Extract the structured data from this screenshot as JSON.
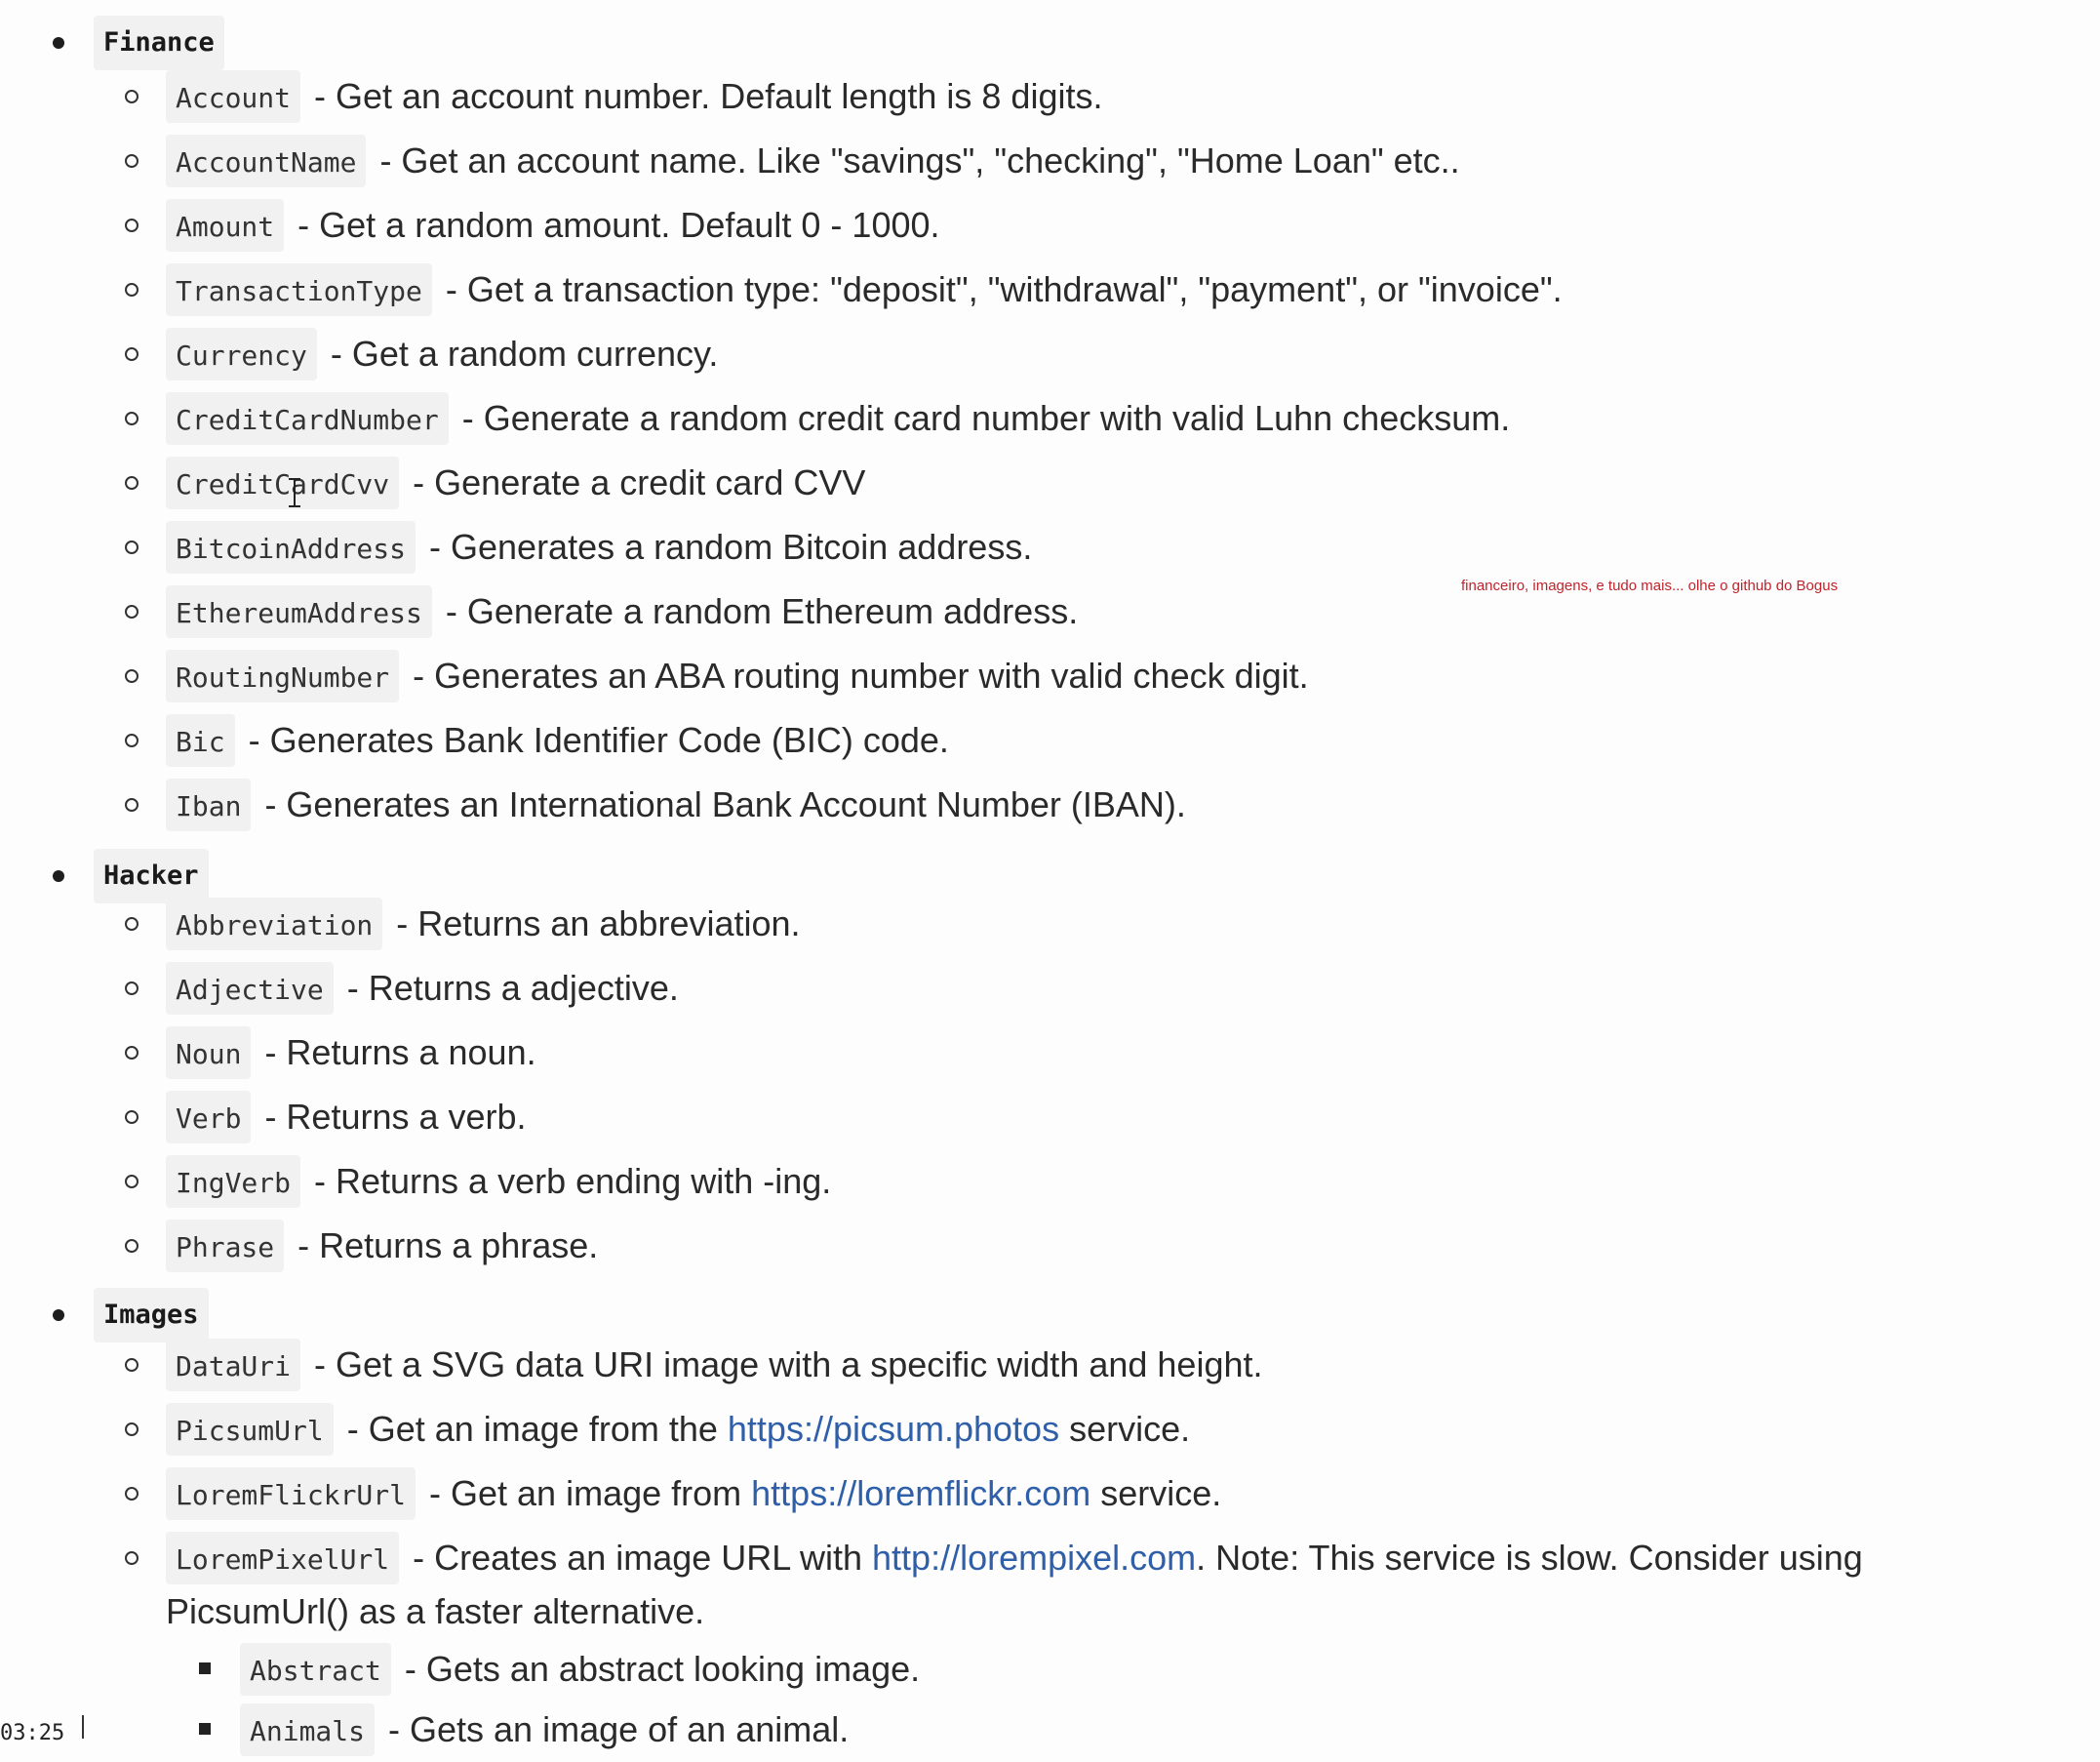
{
  "finance": {
    "heading": "Finance",
    "items": [
      {
        "code": "Account",
        "desc": "- Get an account number. Default length is 8 digits."
      },
      {
        "code": "AccountName",
        "desc": "- Get an account name. Like \"savings\", \"checking\", \"Home Loan\" etc.."
      },
      {
        "code": "Amount",
        "desc": "- Get a random amount. Default 0 - 1000."
      },
      {
        "code": "TransactionType",
        "desc": "- Get a transaction type: \"deposit\", \"withdrawal\", \"payment\", or \"invoice\"."
      },
      {
        "code": "Currency",
        "desc": "- Get a random currency."
      },
      {
        "code": "CreditCardNumber",
        "desc": "- Generate a random credit card number with valid Luhn checksum."
      },
      {
        "code": "CreditCardCvv",
        "desc": "- Generate a credit card CVV"
      },
      {
        "code": "BitcoinAddress",
        "desc": "- Generates a random Bitcoin address."
      },
      {
        "code": "EthereumAddress",
        "desc": "- Generate a random Ethereum address."
      },
      {
        "code": "RoutingNumber",
        "desc": "- Generates an ABA routing number with valid check digit."
      },
      {
        "code": "Bic",
        "desc": "- Generates Bank Identifier Code (BIC) code."
      },
      {
        "code": "Iban",
        "desc": "- Generates an International Bank Account Number (IBAN)."
      }
    ]
  },
  "hacker": {
    "heading": "Hacker",
    "items": [
      {
        "code": "Abbreviation",
        "desc": "- Returns an abbreviation."
      },
      {
        "code": "Adjective",
        "desc": "- Returns a adjective."
      },
      {
        "code": "Noun",
        "desc": "- Returns a noun."
      },
      {
        "code": "Verb",
        "desc": "- Returns a verb."
      },
      {
        "code": "IngVerb",
        "desc": "- Returns a verb ending with -ing."
      },
      {
        "code": "Phrase",
        "desc": "- Returns a phrase."
      }
    ]
  },
  "images": {
    "heading": "Images",
    "items": [
      {
        "code": "DataUri",
        "desc": "- Get a SVG data URI image with a specific width and height."
      },
      {
        "code": "PicsumUrl",
        "pre": "- Get an image from the",
        "link": "https://picsum.photos",
        "post": "service."
      },
      {
        "code": "LoremFlickrUrl",
        "pre": "- Get an image from",
        "link": "https://loremflickr.com",
        "post": "service."
      },
      {
        "code": "LoremPixelUrl",
        "pre": "- Creates an image URL with",
        "link": "http://lorempixel.com",
        "post": ". Note: This service is slow. Consider using",
        "wrap": "PicsumUrl() as a faster alternative."
      }
    ],
    "sub_items": [
      {
        "code": "Abstract",
        "desc": "- Gets an abstract looking image."
      },
      {
        "code": "Animals",
        "desc": "- Gets an image of an animal."
      }
    ]
  },
  "annotation": {
    "text": "financeiro, imagens, e tudo mais... olhe o github do Bogus",
    "color": "#c0232b"
  },
  "timestamp": "03:25"
}
